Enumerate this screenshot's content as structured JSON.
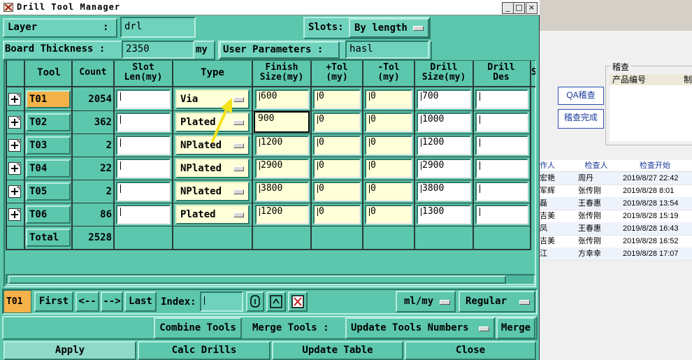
{
  "window": {
    "title": "Drill Tool Manager",
    "buttons": [
      "_",
      "□",
      "×"
    ]
  },
  "top": {
    "layer_label": "Layer",
    "layer_colon": ":",
    "layer_value": "drl",
    "slots_label": "Slots:",
    "slots_value": "By length",
    "board_thickness_label": "Board Thickness :",
    "board_thickness_value": "2350",
    "board_thickness_unit": "my",
    "user_params_label": "User Parameters :",
    "user_params_value": "hasl"
  },
  "table": {
    "headers": {
      "tool": "Tool",
      "count": "Count",
      "slot_len_1": "Slot",
      "slot_len_2": "Len(my)",
      "type": "Type",
      "finish_1": "Finish",
      "finish_2": "Size(my)",
      "ptol_1": "+Tol",
      "ptol_2": "(my)",
      "mtol_1": "-Tol",
      "mtol_2": "(my)",
      "drill_1": "Drill",
      "drill_2": "Size(my)",
      "des_1": "Drill",
      "des_2": "Des"
    },
    "rows": [
      {
        "tool": "T01",
        "count": "2054",
        "slot": "",
        "type": "Via",
        "finish": "600",
        "ptol": "0",
        "mtol": "0",
        "drill": "700",
        "des": ""
      },
      {
        "tool": "T02",
        "count": "362",
        "slot": "",
        "type": "Plated",
        "finish": "900",
        "ptol": "0",
        "mtol": "0",
        "drill": "1000",
        "des": ""
      },
      {
        "tool": "T03",
        "count": "2",
        "slot": "",
        "type": "NPlated",
        "finish": "1200",
        "ptol": "0",
        "mtol": "0",
        "drill": "1200",
        "des": ""
      },
      {
        "tool": "T04",
        "count": "22",
        "slot": "",
        "type": "NPlated",
        "finish": "2900",
        "ptol": "0",
        "mtol": "0",
        "drill": "2900",
        "des": ""
      },
      {
        "tool": "T05",
        "count": "2",
        "slot": "",
        "type": "NPlated",
        "finish": "3800",
        "ptol": "0",
        "mtol": "0",
        "drill": "3800",
        "des": ""
      },
      {
        "tool": "T06",
        "count": "86",
        "slot": "",
        "type": "Plated",
        "finish": "1200",
        "ptol": "0",
        "mtol": "0",
        "drill": "1300",
        "des": ""
      }
    ],
    "total_label": "Total",
    "total_value": "2528"
  },
  "nav": {
    "current_tool": "T01",
    "first": "First",
    "prev": "<--",
    "next": "-->",
    "last": "Last",
    "index_label": "Index:",
    "index_value": "",
    "units": "ml/my",
    "mode": "Regular"
  },
  "tools_row": {
    "combine": "Combine Tools",
    "merge_label": "Merge Tools :",
    "update_numbers": "Update Tools Numbers",
    "merge": "Merge"
  },
  "actions": {
    "apply": "Apply",
    "calc": "Calc Drills",
    "update": "Update Table",
    "close": "Close"
  },
  "background_app": {
    "qa_button": "QA稽查",
    "done_button": "稽查完成",
    "group_label": "稽查",
    "col_product": "产品编号",
    "col_cut": "制",
    "col_author": "作人",
    "col_checker": "检查人",
    "col_start": "检查开始",
    "rows": [
      {
        "a": "宏艳",
        "b": "周丹",
        "c": "2019/8/27  22:42"
      },
      {
        "a": "军辉",
        "b": "张传刚",
        "c": "2019/8/28  8:01"
      },
      {
        "a": "磊",
        "b": "王春惠",
        "c": "2019/8/28  13:54"
      },
      {
        "a": "吉美",
        "b": "张传刚",
        "c": "2019/8/28  15:19"
      },
      {
        "a": "凤",
        "b": "王春惠",
        "c": "2019/8/28  16:43"
      },
      {
        "a": "吉美",
        "b": "张传刚",
        "c": "2019/8/28  16:52"
      },
      {
        "a": "江",
        "b": "方幸幸",
        "c": "2019/8/28  17:07"
      }
    ]
  },
  "colors": {
    "window_bg": "#5cc7ad",
    "field_bg": "#6fd2bd",
    "selected_tool": "#f5b24a",
    "yellow_field": "#ffffd8",
    "annotation_arrow": "#f4e21a"
  }
}
